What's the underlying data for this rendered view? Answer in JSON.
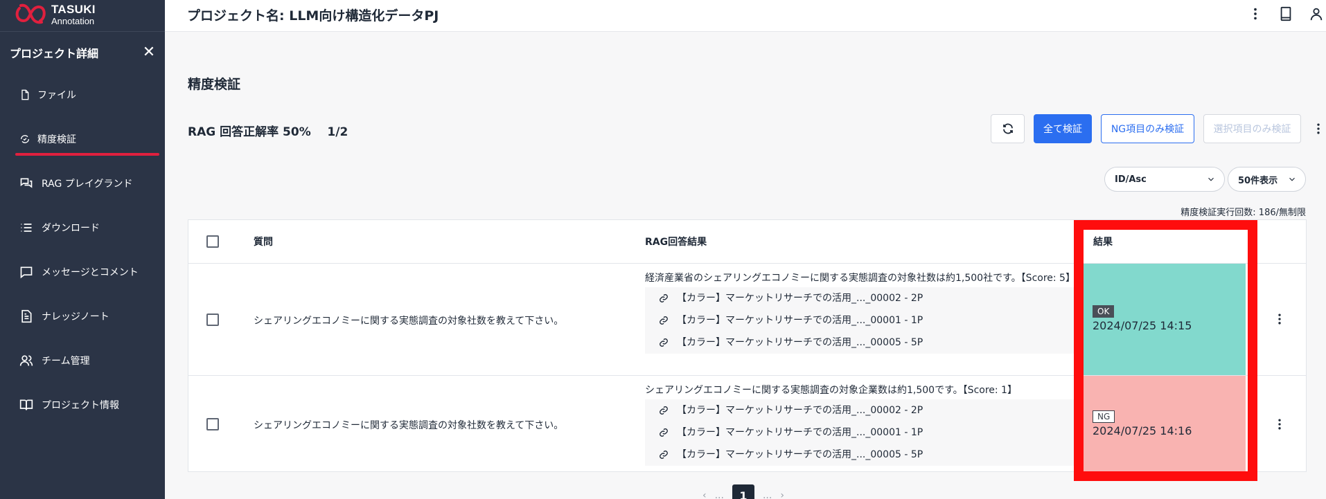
{
  "brand": {
    "line1": "TASUKI",
    "line2": "Annotation",
    "accent": "#e0203e"
  },
  "sidebar": {
    "title": "プロジェクト詳細",
    "items": [
      {
        "label": "ファイル",
        "icon": "file-icon"
      },
      {
        "label": "精度検証",
        "icon": "verify-icon",
        "active": true
      },
      {
        "label": "RAG プレイグランド",
        "icon": "chat-icon"
      },
      {
        "label": "ダウンロード",
        "icon": "list-icon"
      },
      {
        "label": "メッセージとコメント",
        "icon": "message-icon"
      },
      {
        "label": "ナレッジノート",
        "icon": "note-icon"
      },
      {
        "label": "チーム管理",
        "icon": "team-icon"
      },
      {
        "label": "プロジェクト情報",
        "icon": "book-icon"
      }
    ]
  },
  "header": {
    "project_name": "プロジェクト名: LLM向け構造化データPJ"
  },
  "main": {
    "title": "精度検証",
    "rate_label": "RAG 回答正解率 50%",
    "rate_count": "1/2",
    "buttons": {
      "verify_all": "全て検証",
      "verify_ng": "NG項目のみ検証",
      "verify_selected": "選択項目のみ検証"
    },
    "sort_select": "ID/Asc",
    "page_size_select": "50件表示",
    "exec_count": "精度検証実行回数: 186/無制限"
  },
  "table": {
    "headers": {
      "question": "質問",
      "answer": "RAG回答結果",
      "result": "結果"
    },
    "rows": [
      {
        "question": "シェアリングエコノミーに関する実態調査の対象社数を教えて下さい。",
        "answer": "経済産業省のシェアリングエコノミーに関する実態調査の対象社数は約1,500社です。【Score: 5】",
        "sources": [
          "【カラー】マーケットリサーチでの活用_..._00002 - 2P",
          "【カラー】マーケットリサーチでの活用_..._00001 - 1P",
          "【カラー】マーケットリサーチでの活用_..._00005 - 5P"
        ],
        "status": "OK",
        "date": "2024/07/25 14:15",
        "color": "#82d9cd"
      },
      {
        "question": "シェアリングエコノミーに関する実態調査の対象社数を教えて下さい。",
        "answer": "シェアリングエコノミーに関する実態調査の対象企業数は約1,500です。【Score: 1】",
        "sources": [
          "【カラー】マーケットリサーチでの活用_..._00002 - 2P",
          "【カラー】マーケットリサーチでの活用_..._00001 - 1P",
          "【カラー】マーケットリサーチでの活用_..._00005 - 5P"
        ],
        "status": "NG",
        "date": "2024/07/25 14:16",
        "color": "#f9b3b1"
      }
    ]
  },
  "pagination": {
    "current": "1",
    "ellipsis": "..."
  }
}
